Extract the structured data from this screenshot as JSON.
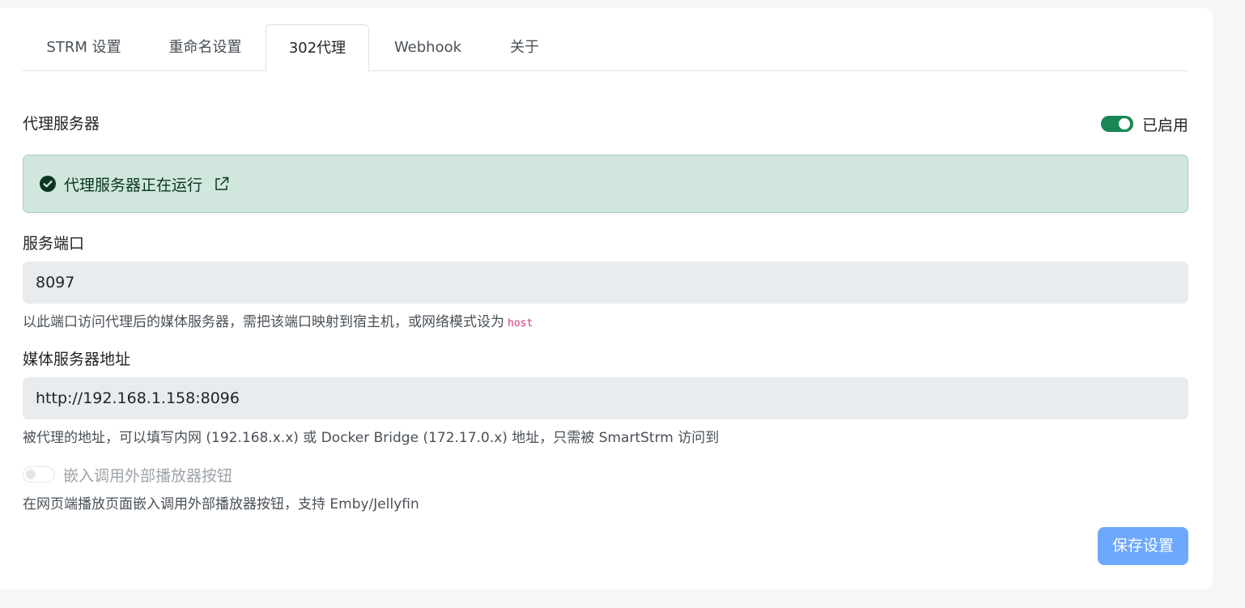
{
  "tabs": [
    {
      "label": "STRM 设置"
    },
    {
      "label": "重命名设置"
    },
    {
      "label": "302代理"
    },
    {
      "label": "Webhook"
    },
    {
      "label": "关于"
    }
  ],
  "active_tab": "302代理",
  "proxy": {
    "title": "代理服务器",
    "enabled_label": "已启用",
    "enabled": true,
    "status_text": "代理服务器正在运行"
  },
  "port": {
    "label": "服务端口",
    "value": "8097",
    "help": "以此端口访问代理后的媒体服务器，需把该端口映射到宿主机，或网络模式设为",
    "help_code": "host"
  },
  "media_server": {
    "label": "媒体服务器地址",
    "value": "http://192.168.1.158:8096",
    "help": "被代理的地址，可以填写内网 (192.168.x.x) 或 Docker Bridge (172.17.0.x) 地址，只需被 SmartStrm 访问到"
  },
  "embed_player": {
    "label": "嵌入调用外部播放器按钮",
    "enabled": false,
    "help": "在网页端播放页面嵌入调用外部播放器按钮，支持 Emby/Jellyfin"
  },
  "save_label": "保存设置",
  "colors": {
    "success": "#198754",
    "alert_bg": "#d1e7dd",
    "primary_disabled": "#6ea8fe"
  }
}
